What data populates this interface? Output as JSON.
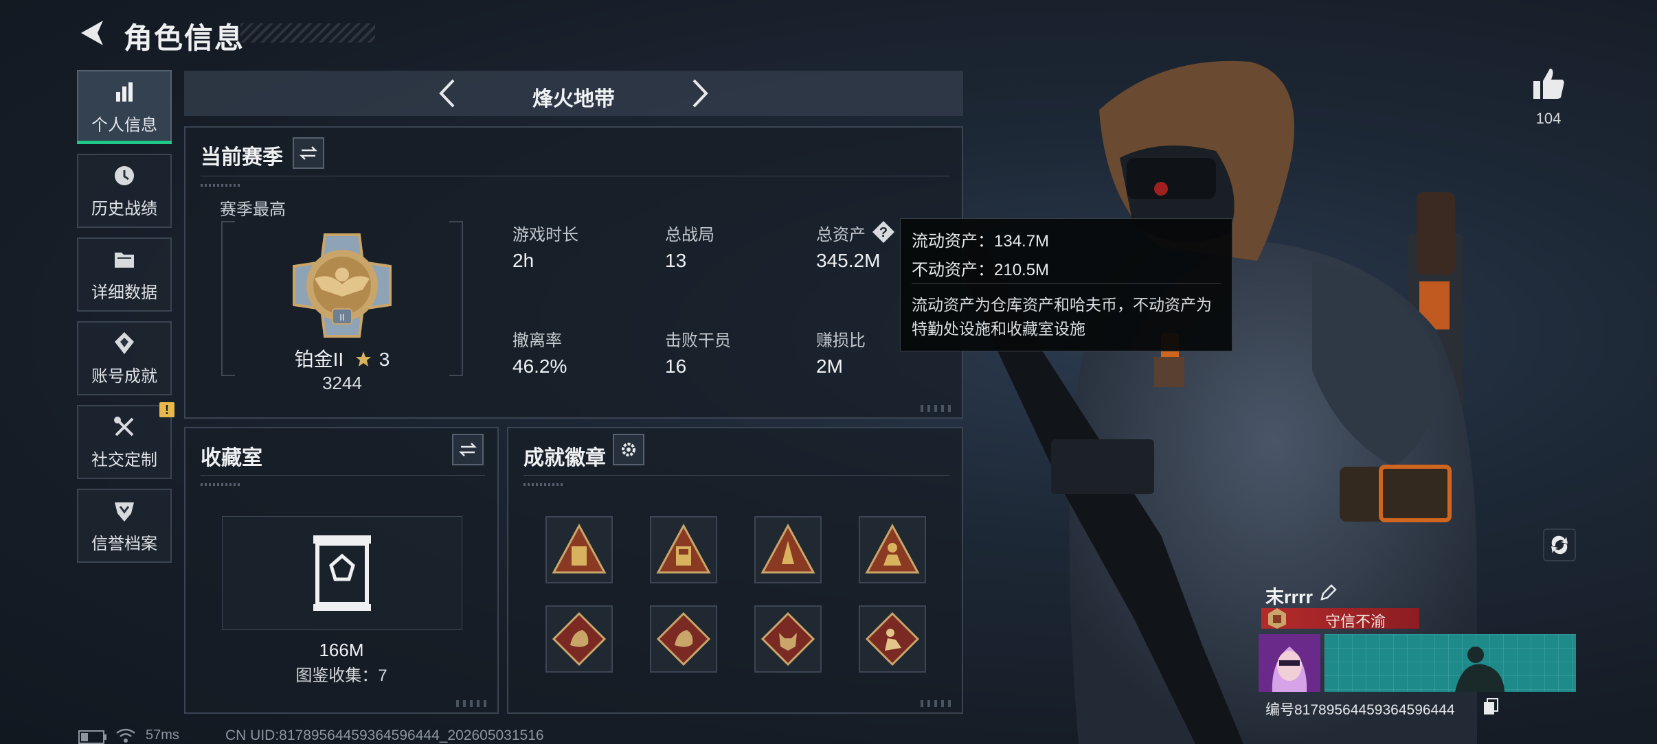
{
  "header": {
    "title": "角色信息"
  },
  "sidebar": {
    "items": [
      {
        "label": "个人信息",
        "icon": "stats-bars-icon",
        "active": true
      },
      {
        "label": "历史战绩",
        "icon": "history-clock-icon"
      },
      {
        "label": "详细数据",
        "icon": "folder-icon"
      },
      {
        "label": "账号成就",
        "icon": "achievement-icon"
      },
      {
        "label": "社交定制",
        "icon": "wrench-screwdriver-icon",
        "badge": "!"
      },
      {
        "label": "信誉档案",
        "icon": "reputation-shield-icon"
      }
    ]
  },
  "mode": {
    "title": "烽火地带"
  },
  "season": {
    "title": "当前赛季",
    "best_label": "赛季最高",
    "rank_name": "铂金II",
    "rank_stars": "3",
    "rank_points": "3244",
    "stats": [
      {
        "label": "游戏时长",
        "value": "2h"
      },
      {
        "label": "总战局",
        "value": "13"
      },
      {
        "label": "总资产",
        "value": "345.2M"
      },
      {
        "label": "撤离率",
        "value": "46.2%"
      },
      {
        "label": "击败干员",
        "value": "16"
      },
      {
        "label": "赚损比",
        "value": "2M"
      }
    ]
  },
  "tooltip": {
    "liquid": "流动资产：134.7M",
    "fixed": "不动资产：210.5M",
    "note": "流动资产为仓库资产和哈夫币，不动资产为特勤处设施和收藏室设施"
  },
  "vault": {
    "title": "收藏室",
    "value": "166M",
    "collection": "图鉴收集：7"
  },
  "badges": {
    "title": "成就徽章"
  },
  "social": {
    "likes": "104"
  },
  "player": {
    "name": "末rrrr",
    "title": "守信不渝",
    "id": "编号817895644593645964​44"
  },
  "footer": {
    "ping": "57ms",
    "uid": "CN UID:81789564459364596444_202605031516"
  },
  "colors": {
    "accent_green": "#1ec98a",
    "title_red": "#b52a2a",
    "warning_yellow": "#e8b84a",
    "gold": "#c9a56a"
  }
}
